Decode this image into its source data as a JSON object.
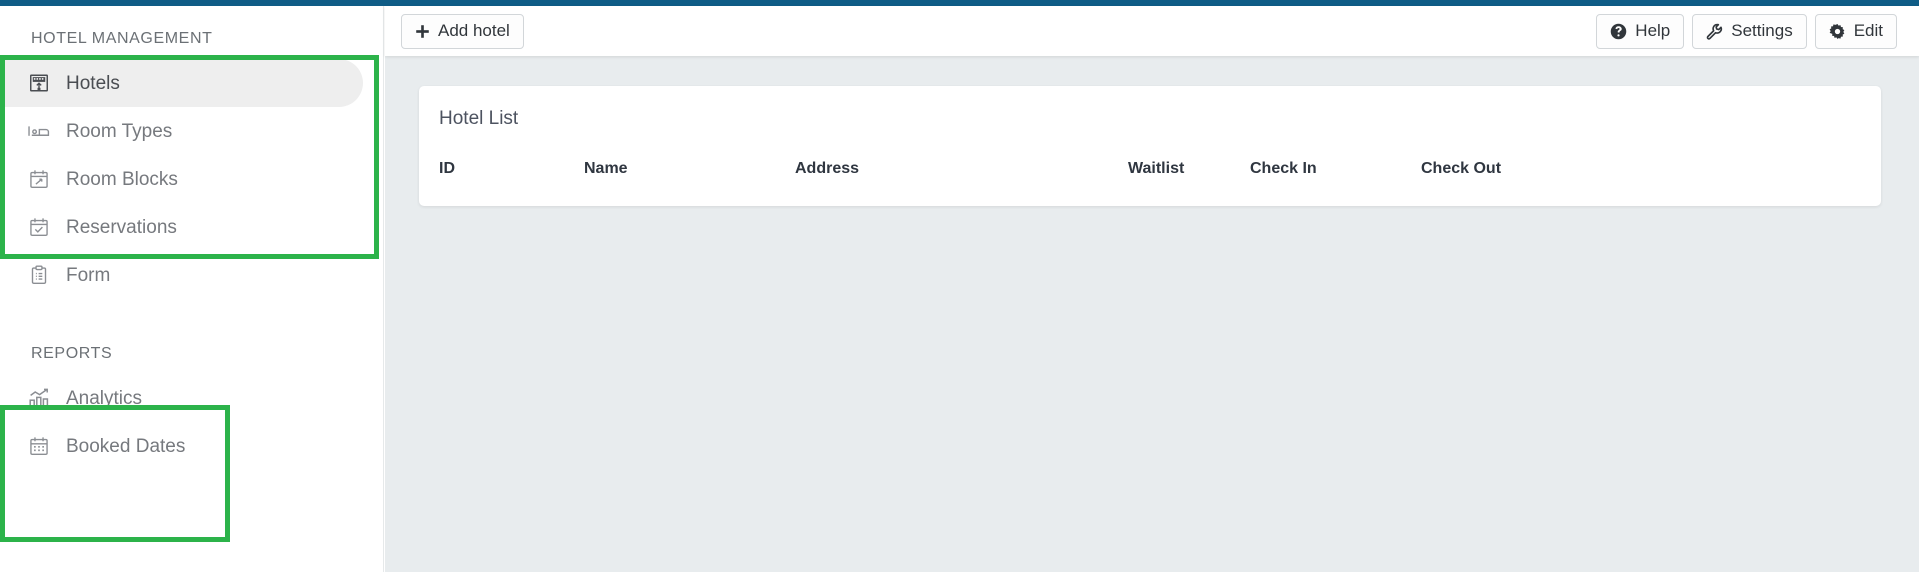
{
  "theme": {
    "top_bar_color": "#0f5c86",
    "annotation_color": "#2cb34a",
    "content_bg": "#e8ecee",
    "active_item_bg": "#eeeeee"
  },
  "sidebar": {
    "sections": [
      {
        "title": "HOTEL MANAGEMENT",
        "items": [
          {
            "label": "Hotels",
            "icon": "hotel-icon",
            "active": true
          },
          {
            "label": "Room Types",
            "icon": "bed-icon",
            "active": false
          },
          {
            "label": "Room Blocks",
            "icon": "calendar-edit-icon",
            "active": false
          },
          {
            "label": "Reservations",
            "icon": "calendar-check-icon",
            "active": false
          },
          {
            "label": "Form",
            "icon": "clipboard-list-icon",
            "active": false
          }
        ]
      },
      {
        "title": "REPORTS",
        "items": [
          {
            "label": "Analytics",
            "icon": "chart-bar-icon",
            "active": false
          },
          {
            "label": "Booked Dates",
            "icon": "calendar-grid-icon",
            "active": false
          }
        ]
      }
    ]
  },
  "toolbar": {
    "add_hotel_label": "Add hotel",
    "add_hotel_icon": "plus-icon",
    "help_label": "Help",
    "help_icon": "question-circle-icon",
    "settings_label": "Settings",
    "settings_icon": "wrench-icon",
    "edit_label": "Edit",
    "edit_icon": "gear-icon"
  },
  "main": {
    "card": {
      "title": "Hotel List",
      "table": {
        "columns": [
          "ID",
          "Name",
          "Address",
          "Waitlist",
          "Check In",
          "Check Out"
        ],
        "rows": []
      }
    }
  }
}
